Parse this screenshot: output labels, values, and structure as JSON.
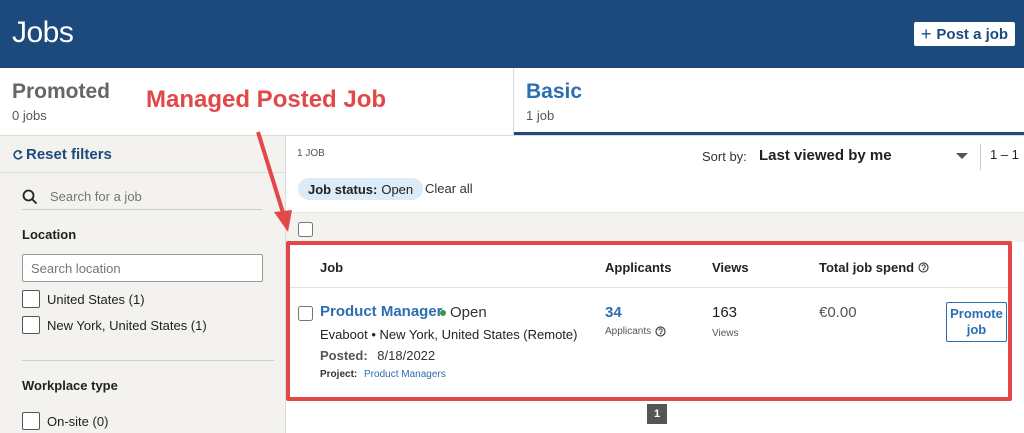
{
  "header": {
    "title": "Jobs",
    "post_label": "Post a job",
    "post_icon": "plus-icon"
  },
  "tabs": [
    {
      "label": "Promoted",
      "sub": "0 jobs"
    },
    {
      "label": "Basic",
      "sub": "1 job"
    }
  ],
  "annotation": {
    "text": "Managed Posted Job",
    "color": "#e24848"
  },
  "sidebar": {
    "reset_label": "Reset filters",
    "search_placeholder": "Search for a job",
    "location_heading": "Location",
    "location_placeholder": "Search location",
    "locations": [
      "United States (1)",
      "New York, United States (1)"
    ],
    "workplace_heading": "Workplace type",
    "workplace_options": [
      "On-site (0)"
    ]
  },
  "results": {
    "count_label": "1 JOB",
    "sort_label": "Sort by:",
    "sort_value": "Last viewed by me",
    "range_label": "1 – 1",
    "filter_chip": {
      "key": "Job status:",
      "value": "Open"
    },
    "clear_all": "Clear all"
  },
  "table": {
    "columns": {
      "job": "Job",
      "applicants": "Applicants",
      "views": "Views",
      "spend": "Total job spend"
    },
    "row": {
      "title": "Product Manager",
      "status": "Open",
      "company": "Evaboot",
      "location": "New York, United States (Remote)",
      "posted_label": "Posted:",
      "posted_date": "8/18/2022",
      "project_label": "Project:",
      "project_name": "Product Managers",
      "applicants_count": "34",
      "applicants_label": "Applicants",
      "views_count": "163",
      "views_label": "Views",
      "spend": "€0.00",
      "promote_line1": "Promote",
      "promote_line2": "job"
    }
  },
  "pagination": {
    "current": "1"
  },
  "colors": {
    "brand": "#1d4a7d",
    "link": "#2a6fb0",
    "highlight": "#e24848",
    "status_open": "#3c9b3c"
  }
}
